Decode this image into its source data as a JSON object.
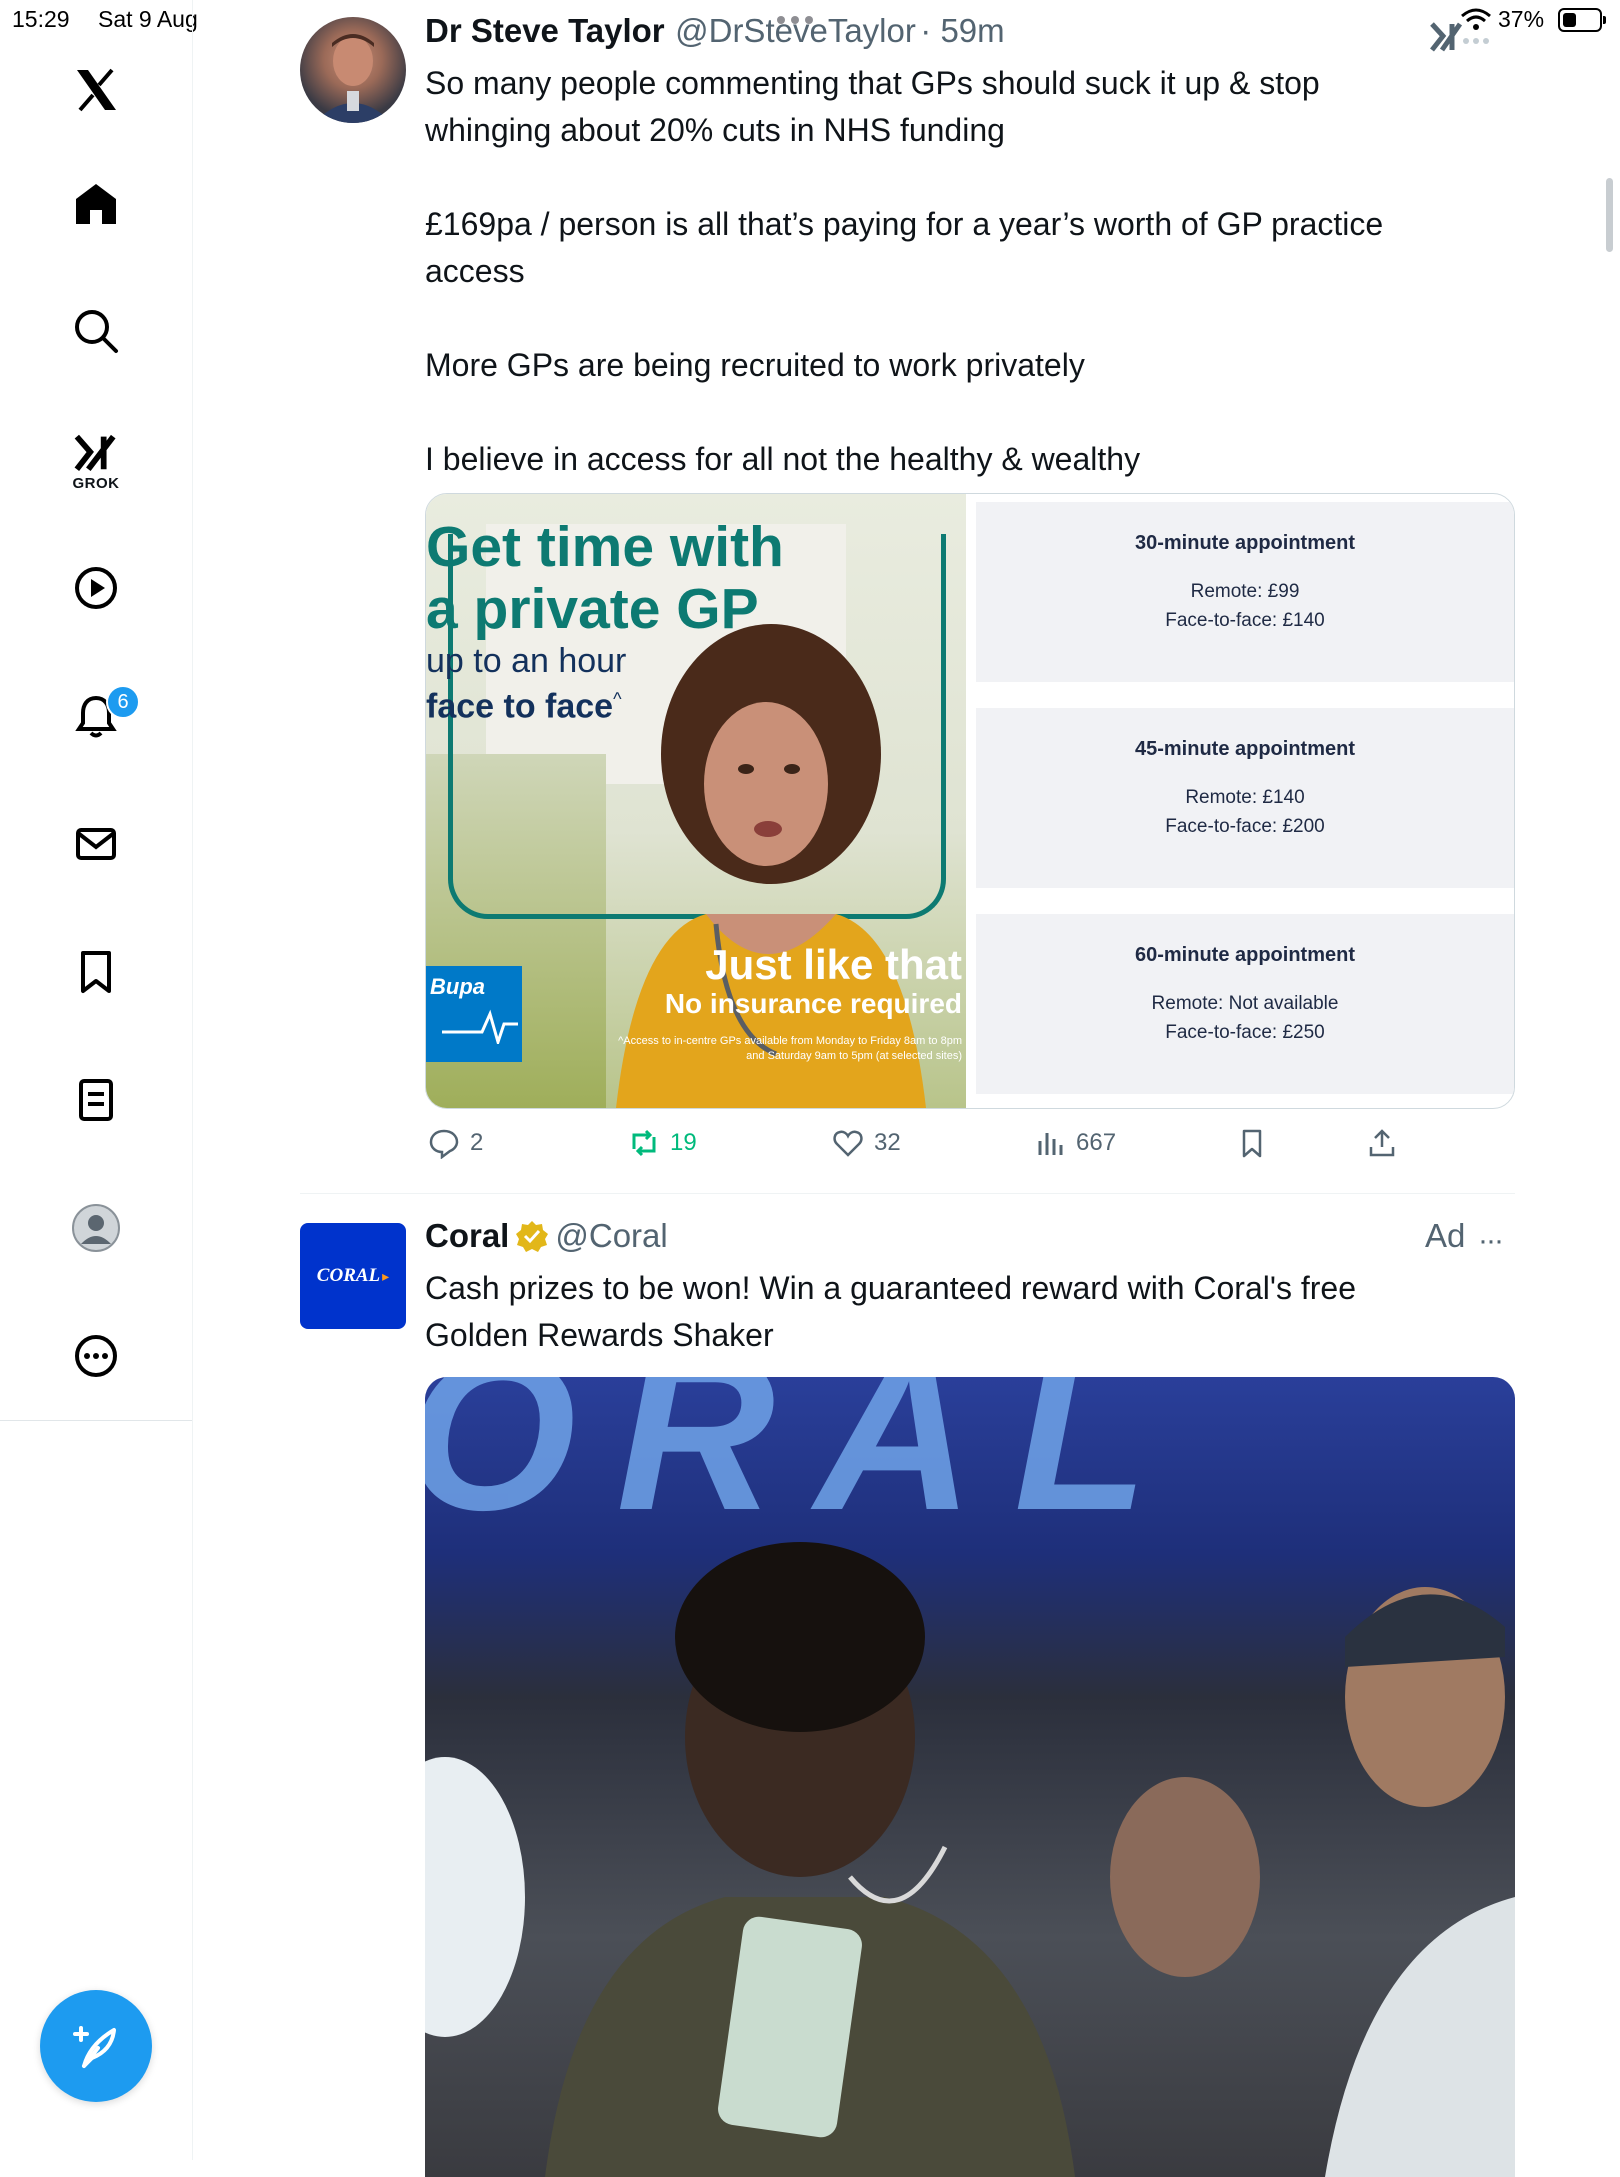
{
  "status_bar": {
    "time": "15:29",
    "date": "Sat 9 Aug",
    "battery": "37%",
    "battery_level": 0.37
  },
  "sidebar": {
    "items": [
      {
        "name": "x-logo",
        "icon": "x-logo-icon"
      },
      {
        "name": "home",
        "icon": "home-icon"
      },
      {
        "name": "explore",
        "icon": "search-icon"
      },
      {
        "name": "grok",
        "icon": "grok-icon",
        "label": "GROK"
      },
      {
        "name": "videos",
        "icon": "play-icon"
      },
      {
        "name": "notifications",
        "icon": "bell-icon",
        "badge": "6"
      },
      {
        "name": "messages",
        "icon": "mail-icon"
      },
      {
        "name": "bookmarks",
        "icon": "bookmark-icon"
      },
      {
        "name": "lists",
        "icon": "list-icon"
      },
      {
        "name": "profile",
        "icon": "profile-avatar-icon"
      },
      {
        "name": "more",
        "icon": "more-circle-icon"
      }
    ],
    "compose_icon": "compose-feather-icon"
  },
  "tweets": [
    {
      "author": "Dr Steve Taylor",
      "handle": "@DrSteveTaylor",
      "time": "· 59m",
      "text": "So many people commenting that GPs should suck it up & stop\nwhinging about 20% cuts in NHS funding\n\n£169pa / person is all that’s paying for a year’s worth of GP practice\naccess\n\nMore GPs are being recruited to work privately\n\nI believe in access for all not the healthy & wealthy",
      "media": {
        "ad_headline_1": "Get time with",
        "ad_headline_2": "a private GP",
        "ad_sub_1": "up to an hour",
        "ad_sub_2": "face to face",
        "ad_caret": "^",
        "ad_tagline_1": "Just like that",
        "ad_tagline_2": "No insurance required",
        "ad_footnote_1": "^Access to in-centre GPs available from Monday to Friday 8am to 8pm",
        "ad_footnote_2": "and Saturday 9am to 5pm (at selected sites)",
        "brand": "Bupa",
        "prices": [
          {
            "title": "30-minute appointment",
            "remote": "Remote: £99",
            "face": "Face-to-face: £140"
          },
          {
            "title": "45-minute appointment",
            "remote": "Remote: £140",
            "face": "Face-to-face: £200"
          },
          {
            "title": "60-minute appointment",
            "remote": "Remote: Not available",
            "face": "Face-to-face: £250"
          }
        ]
      },
      "stats": {
        "replies": "2",
        "reposts": "19",
        "likes": "32",
        "views": "667"
      }
    },
    {
      "author": "Coral",
      "handle": "@Coral",
      "ad_label": "Ad",
      "more": "···",
      "avatar_text": "CORAL",
      "text": "Cash prizes to be won! Win a guaranteed reward with Coral's free\nGolden Rewards Shaker",
      "media_banner": "ORAL"
    }
  ],
  "colors": {
    "accent": "#1d9bf0",
    "repost_green": "#00ba7c",
    "coral_blue": "#0033cc",
    "bupa_blue": "#0079c8",
    "bupa_teal": "#0d7a72"
  }
}
